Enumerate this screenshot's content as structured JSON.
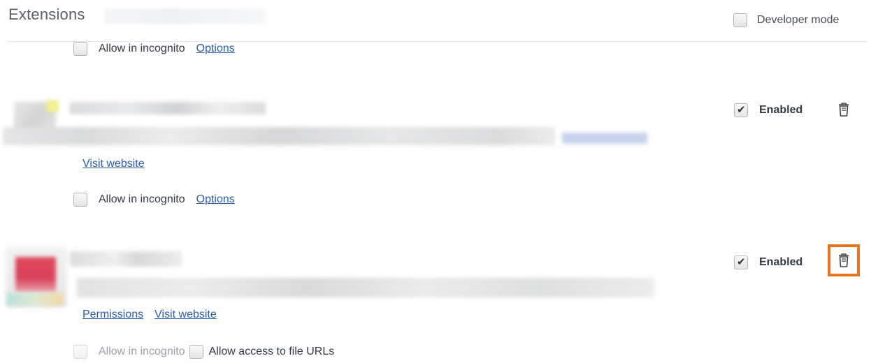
{
  "header": {
    "title": "Extensions",
    "developer_mode_label": "Developer mode"
  },
  "extensions": [
    {
      "allow_incognito_label": "Allow in incognito",
      "options_label": "Options"
    },
    {
      "enabled_label": "Enabled",
      "enabled": true,
      "visit_website_label": "Visit website",
      "allow_incognito_label": "Allow in incognito",
      "options_label": "Options",
      "delete_icon": "trash-icon"
    },
    {
      "enabled_label": "Enabled",
      "enabled": true,
      "permissions_label": "Permissions",
      "visit_website_label": "Visit website",
      "allow_incognito_label": "Allow in incognito",
      "allow_file_urls_label": "Allow access to file URLs",
      "delete_icon": "trash-icon",
      "delete_highlight_color": "#e8741e"
    }
  ],
  "colors": {
    "link": "#2a5db0",
    "highlight": "#e8741e",
    "title": "#5c6166"
  }
}
